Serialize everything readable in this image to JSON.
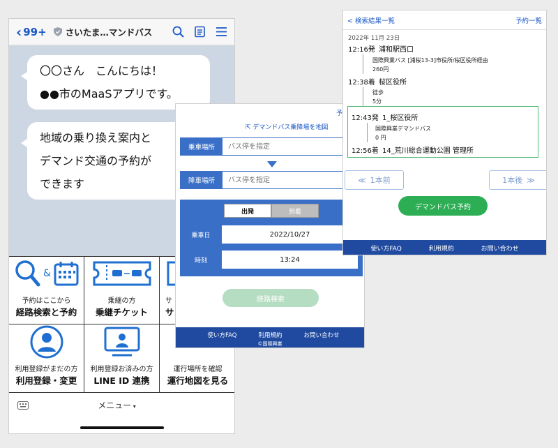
{
  "phone": {
    "back_label": "99+",
    "title": "さいたま…マンドバス",
    "bubble1": [
      "〇〇さん　こんにちは！",
      "●●市のMaaSアプリです。"
    ],
    "bubble2": [
      "地域の乗り換え案内と",
      "デマンド交通の予約が",
      "できます"
    ],
    "menu": [
      {
        "small": "予約はここから",
        "large": "経路検索と予約"
      },
      {
        "small": "乗継の方",
        "large": "乗継チケット"
      },
      {
        "small": "サ",
        "large": "サ"
      },
      {
        "small": "利用登録がまだの方",
        "large": "利用登録・変更"
      },
      {
        "small": "利用登録お済みの方",
        "large": "LINE ID 連携"
      },
      {
        "small": "運行場所を確認",
        "large": "運行地図を見る"
      }
    ],
    "menu_bar_label": "メニュー",
    "amp": "&"
  },
  "search": {
    "top_link": "予",
    "map_link": "デマンドバス乗降場を地図",
    "board_label": "乗車場所",
    "board_placeholder": "バス停を指定",
    "alight_label": "降車場所",
    "alight_placeholder": "バス停を指定",
    "depart_tab": "出発",
    "arrive_tab": "到着",
    "date_label": "乗車日",
    "date_value": "2022/10/27",
    "time_label": "時刻",
    "time_value": "13:24",
    "search_button": "経路検索",
    "footer": [
      "使い方FAQ",
      "利用規約",
      "お問い合わせ"
    ],
    "copyright": "©国際興業"
  },
  "result": {
    "back_link": "検索結果一覧",
    "reservations_link": "予約一覧",
    "date": "2022年 11月 23日",
    "legs": [
      {
        "time": "12:16発",
        "place": "浦和駅西口"
      },
      {
        "time": "12:38着",
        "place": "桜区役所"
      },
      {
        "time": "12:43発",
        "place": "1_桜区役所"
      },
      {
        "time": "12:56着",
        "place": "14_荒川総合運動公園 管理所"
      }
    ],
    "seg1": [
      "国際興業バス [浦桜13-3]市役所/桜区役所経由",
      "260円"
    ],
    "seg2": [
      "徒歩",
      "5分"
    ],
    "seg3": [
      "国際興業デマンドバス",
      "0 円"
    ],
    "prev_button": "1本前",
    "next_button": "1本後",
    "book_button": "デマンドバス予約",
    "footer": [
      "使い方FAQ",
      "利用規約",
      "お問い合わせ"
    ]
  },
  "colors": {
    "brand_blue": "#1f4aa0",
    "accent_blue": "#3a6fc8",
    "green": "#2dae55"
  }
}
